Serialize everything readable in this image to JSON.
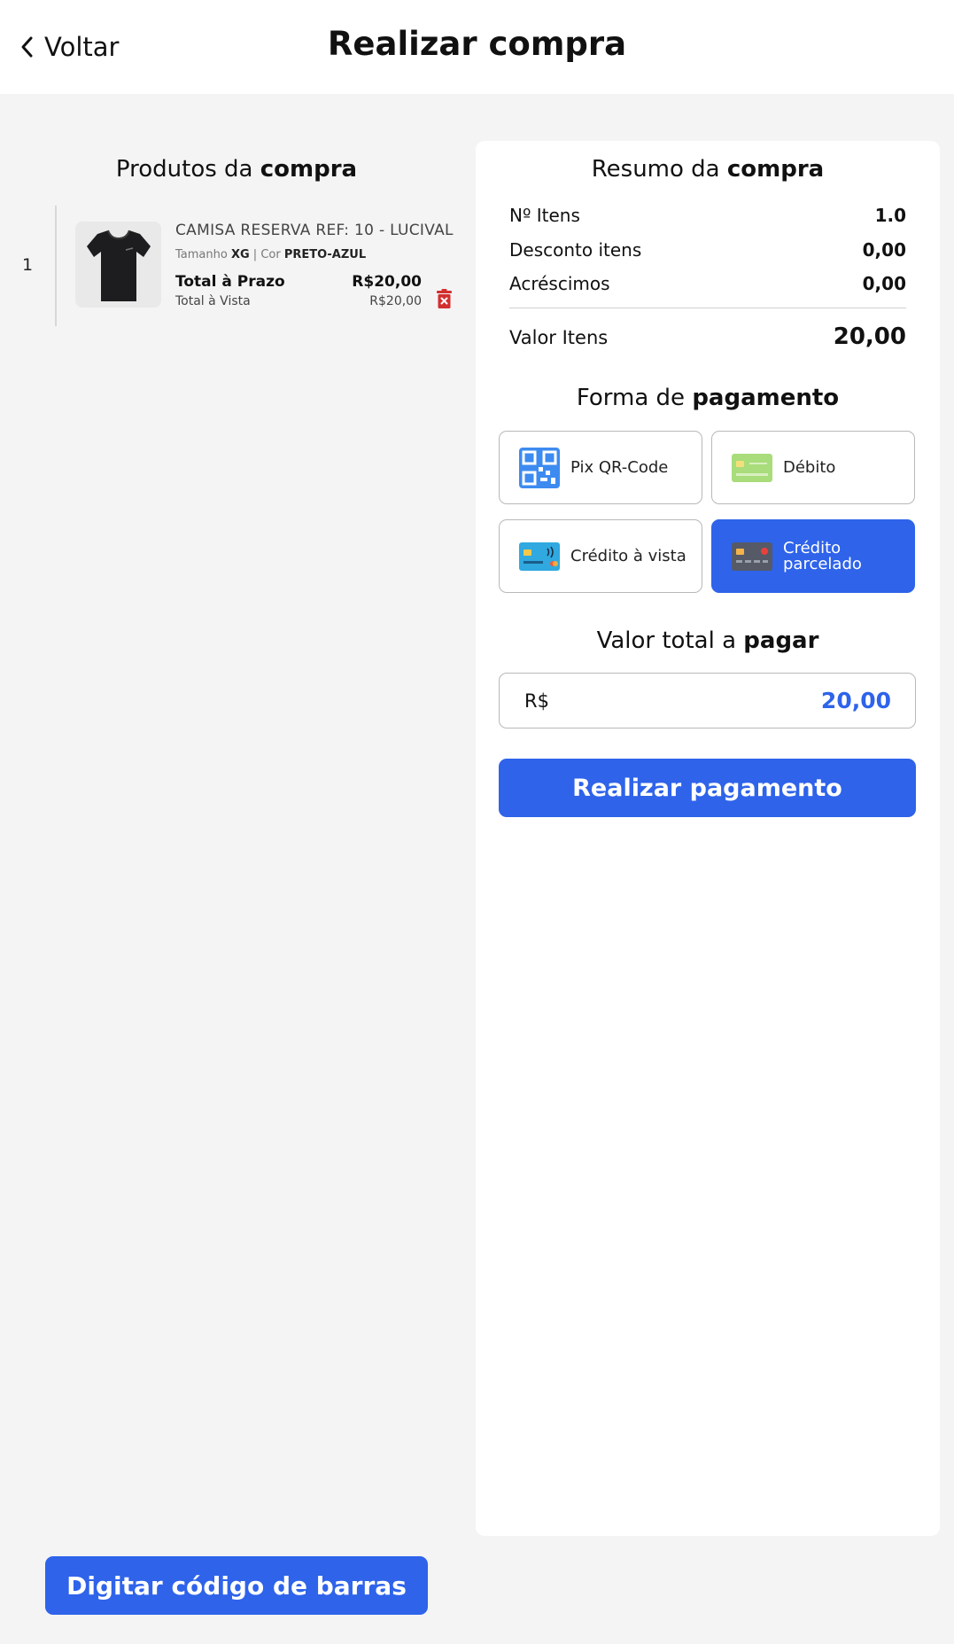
{
  "header": {
    "back_label": "Voltar",
    "title": "Realizar compra"
  },
  "products": {
    "title_prefix": "Produtos da ",
    "title_bold": "compra",
    "items": [
      {
        "index": "1",
        "name": "CAMISA RESERVA   REF: 10 - LUCIVAL",
        "size_label": "Tamanho ",
        "size": "XG",
        "sep": " | ",
        "color_label": "Cor ",
        "color": "PRETO-AZUL",
        "prazo_label": "Total à Prazo",
        "prazo_value": "R$20,00",
        "vista_label": "Total à Vista",
        "vista_value": "R$20,00"
      }
    ]
  },
  "summary": {
    "title_prefix": "Resumo da ",
    "title_bold": "compra",
    "rows": [
      {
        "label": "Nº Itens",
        "value": "1.0"
      },
      {
        "label": "Desconto itens",
        "value": "0,00"
      },
      {
        "label": "Acréscimos",
        "value": "0,00"
      }
    ],
    "total_label": "Valor Itens",
    "total_value": "20,00"
  },
  "payment": {
    "title_prefix": "Forma de ",
    "title_bold": "pagamento",
    "options": [
      {
        "label": "Pix QR-Code",
        "icon": "qr-code-icon",
        "selected": false
      },
      {
        "label": "Débito",
        "icon": "debit-card-icon",
        "selected": false
      },
      {
        "label": "Crédito à vista",
        "icon": "credit-card-icon",
        "selected": false
      },
      {
        "label": "Crédito parcelado",
        "icon": "installment-card-icon",
        "selected": true
      }
    ]
  },
  "total_pay": {
    "title_prefix": "Valor total a ",
    "title_bold": "pagar",
    "currency": "R$",
    "amount": "20,00"
  },
  "actions": {
    "pay_label": "Realizar pagamento",
    "barcode_label": "Digitar código de barras"
  },
  "colors": {
    "accent": "#2e63ea",
    "background": "#f4f4f4",
    "delete": "#d32f2f"
  }
}
